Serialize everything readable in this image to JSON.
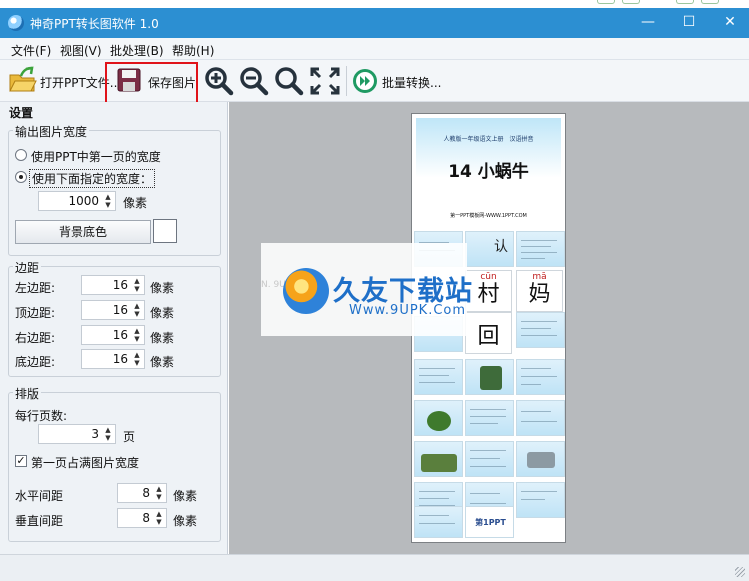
{
  "window": {
    "title": "神奇PPT转长图软件 1.0",
    "controls": {
      "minimize": "—",
      "maximize": "☐",
      "close": "✕"
    }
  },
  "menu": [
    "文件(F)",
    "视图(V)",
    "批处理(B)",
    "帮助(H)"
  ],
  "toolbar": {
    "open_label": "打开PPT文件..",
    "save_label": "保存图片",
    "batch_label": "批量转换..."
  },
  "settings": {
    "title": "设置",
    "output_width": {
      "title": "输出图片宽度",
      "option_first_page": "使用PPT中第一页的宽度",
      "option_specified": "使用下面指定的宽度：",
      "selected": "使用下面指定的宽度：",
      "width_value": "1000",
      "unit": "像素",
      "bg_button": "背景底色",
      "bg_color": "#ffffff"
    },
    "margins": {
      "title": "边距",
      "unit": "像素",
      "items": [
        {
          "label": "左边距:",
          "value": "16"
        },
        {
          "label": "顶边距:",
          "value": "16"
        },
        {
          "label": "右边距:",
          "value": "16"
        },
        {
          "label": "底边距:",
          "value": "16"
        }
      ]
    },
    "layout": {
      "title": "排版",
      "per_row_label": "每行页数:",
      "per_row_value": "3",
      "per_row_unit": "页",
      "first_page_full_label": "第一页占满图片宽度",
      "first_page_full_checked": true,
      "h_gap_label": "水平间距",
      "h_gap_value": "8",
      "v_gap_label": "垂直间距",
      "v_gap_value": "8",
      "unit": "像素"
    }
  },
  "preview": {
    "header": "人教版一年级语文上册　汉语拼音",
    "lesson": "14 小蜗牛",
    "site": "第一PPT模板网-WWW.1PPT.COM",
    "chars": [
      {
        "pinyin": "cūn",
        "char": "村"
      },
      {
        "pinyin": "mā",
        "char": "妈"
      },
      {
        "pinyin": "",
        "char": "回"
      }
    ],
    "side_text": "认",
    "banner_text": "第1PPT",
    "watermark": {
      "title": "久友下载站",
      "url": "Www.9UPK.Com",
      "ghost": "N. 9UPK. COM"
    }
  }
}
